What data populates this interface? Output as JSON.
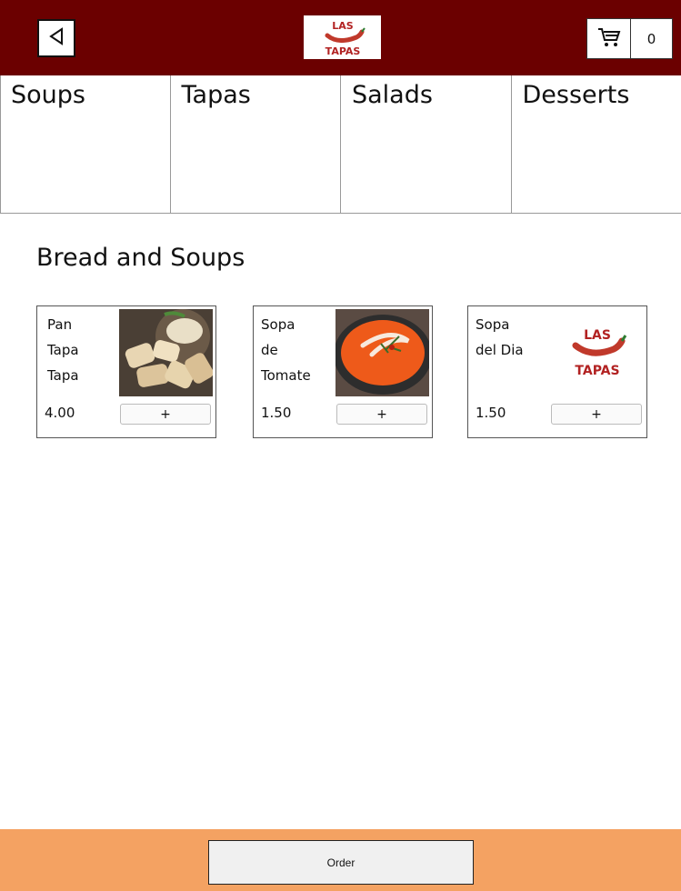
{
  "header": {
    "logo_line1": "LAS",
    "logo_line2": "TAPAS",
    "cart_count": "0",
    "background": "#6b0000",
    "logo_color": "#b22222"
  },
  "tabs": [
    {
      "label": "Soups"
    },
    {
      "label": "Tapas"
    },
    {
      "label": "Salads"
    },
    {
      "label": "Desserts"
    }
  ],
  "section_title": "Bread and Soups",
  "products": [
    {
      "name_lines": [
        "Pan",
        "Tapa",
        "Tapa"
      ],
      "price": "4.00",
      "add_label": "+",
      "image": "bread-photo"
    },
    {
      "name_lines": [
        "Sopa",
        "de",
        "Tomate"
      ],
      "price": "1.50",
      "add_label": "+",
      "image": "tomato-soup-photo"
    },
    {
      "name_lines": [
        "Sopa",
        "del Dia"
      ],
      "price": "1.50",
      "add_label": "+",
      "image": "las-tapas-logo"
    }
  ],
  "footer": {
    "order_label": "Order",
    "background": "#f4a262"
  }
}
